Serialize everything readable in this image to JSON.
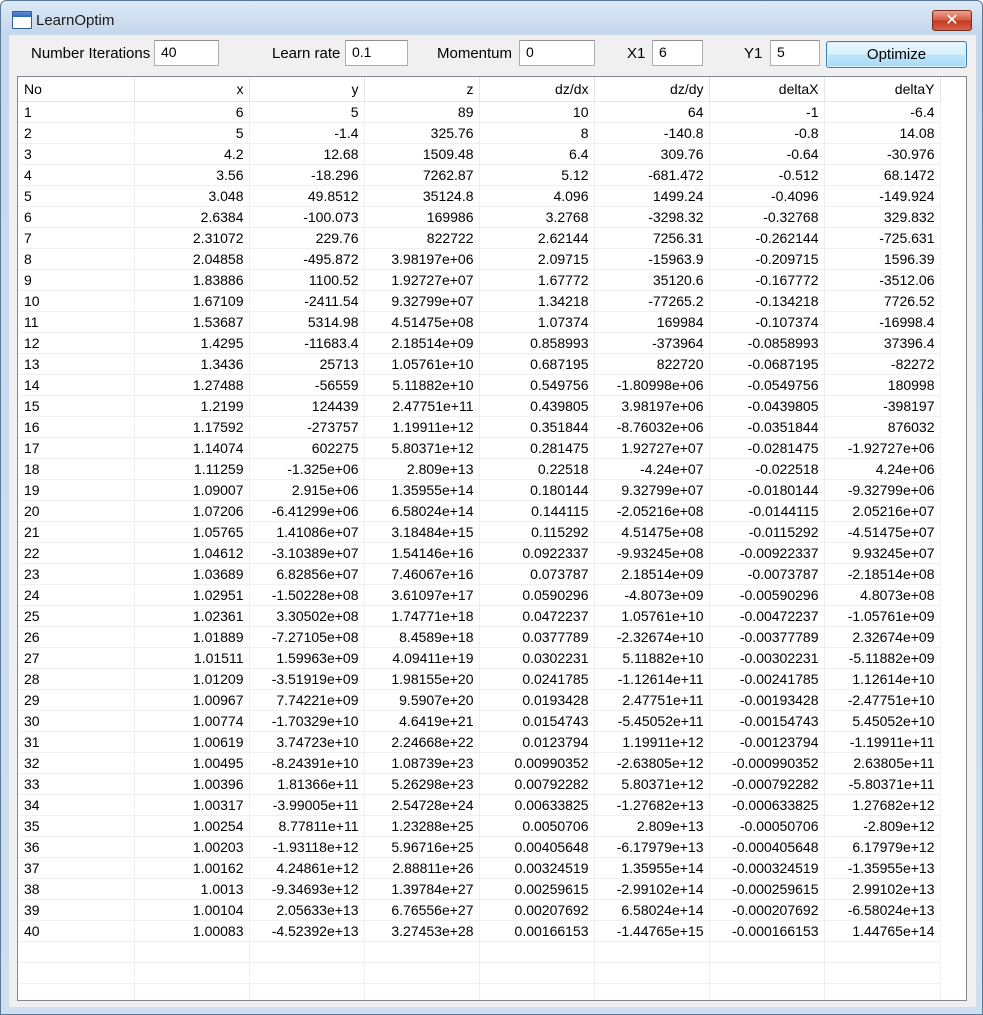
{
  "window": {
    "title": "LearnOptim",
    "close_label": "✕"
  },
  "toolbar": {
    "iterations_label": "Number Iterations",
    "iterations_value": "40",
    "learn_rate_label": "Learn rate",
    "learn_rate_value": "0.1",
    "momentum_label": "Momentum",
    "momentum_value": "0",
    "x1_label": "X1",
    "x1_value": "6",
    "y1_label": "Y1",
    "y1_value": "5",
    "optimize_label": "Optimize"
  },
  "table": {
    "columns": [
      "No",
      "x",
      "y",
      "z",
      "dz/dx",
      "dz/dy",
      "deltaX",
      "deltaY"
    ],
    "rows": [
      [
        "1",
        "6",
        "5",
        "89",
        "10",
        "64",
        "-1",
        "-6.4"
      ],
      [
        "2",
        "5",
        "-1.4",
        "325.76",
        "8",
        "-140.8",
        "-0.8",
        "14.08"
      ],
      [
        "3",
        "4.2",
        "12.68",
        "1509.48",
        "6.4",
        "309.76",
        "-0.64",
        "-30.976"
      ],
      [
        "4",
        "3.56",
        "-18.296",
        "7262.87",
        "5.12",
        "-681.472",
        "-0.512",
        "68.1472"
      ],
      [
        "5",
        "3.048",
        "49.8512",
        "35124.8",
        "4.096",
        "1499.24",
        "-0.4096",
        "-149.924"
      ],
      [
        "6",
        "2.6384",
        "-100.073",
        "169986",
        "3.2768",
        "-3298.32",
        "-0.32768",
        "329.832"
      ],
      [
        "7",
        "2.31072",
        "229.76",
        "822722",
        "2.62144",
        "7256.31",
        "-0.262144",
        "-725.631"
      ],
      [
        "8",
        "2.04858",
        "-495.872",
        "3.98197e+06",
        "2.09715",
        "-15963.9",
        "-0.209715",
        "1596.39"
      ],
      [
        "9",
        "1.83886",
        "1100.52",
        "1.92727e+07",
        "1.67772",
        "35120.6",
        "-0.167772",
        "-3512.06"
      ],
      [
        "10",
        "1.67109",
        "-2411.54",
        "9.32799e+07",
        "1.34218",
        "-77265.2",
        "-0.134218",
        "7726.52"
      ],
      [
        "11",
        "1.53687",
        "5314.98",
        "4.51475e+08",
        "1.07374",
        "169984",
        "-0.107374",
        "-16998.4"
      ],
      [
        "12",
        "1.4295",
        "-11683.4",
        "2.18514e+09",
        "0.858993",
        "-373964",
        "-0.0858993",
        "37396.4"
      ],
      [
        "13",
        "1.3436",
        "25713",
        "1.05761e+10",
        "0.687195",
        "822720",
        "-0.0687195",
        "-82272"
      ],
      [
        "14",
        "1.27488",
        "-56559",
        "5.11882e+10",
        "0.549756",
        "-1.80998e+06",
        "-0.0549756",
        "180998"
      ],
      [
        "15",
        "1.2199",
        "124439",
        "2.47751e+11",
        "0.439805",
        "3.98197e+06",
        "-0.0439805",
        "-398197"
      ],
      [
        "16",
        "1.17592",
        "-273757",
        "1.19911e+12",
        "0.351844",
        "-8.76032e+06",
        "-0.0351844",
        "876032"
      ],
      [
        "17",
        "1.14074",
        "602275",
        "5.80371e+12",
        "0.281475",
        "1.92727e+07",
        "-0.0281475",
        "-1.92727e+06"
      ],
      [
        "18",
        "1.11259",
        "-1.325e+06",
        "2.809e+13",
        "0.22518",
        "-4.24e+07",
        "-0.022518",
        "4.24e+06"
      ],
      [
        "19",
        "1.09007",
        "2.915e+06",
        "1.35955e+14",
        "0.180144",
        "9.32799e+07",
        "-0.0180144",
        "-9.32799e+06"
      ],
      [
        "20",
        "1.07206",
        "-6.41299e+06",
        "6.58024e+14",
        "0.144115",
        "-2.05216e+08",
        "-0.0144115",
        "2.05216e+07"
      ],
      [
        "21",
        "1.05765",
        "1.41086e+07",
        "3.18484e+15",
        "0.115292",
        "4.51475e+08",
        "-0.0115292",
        "-4.51475e+07"
      ],
      [
        "22",
        "1.04612",
        "-3.10389e+07",
        "1.54146e+16",
        "0.0922337",
        "-9.93245e+08",
        "-0.00922337",
        "9.93245e+07"
      ],
      [
        "23",
        "1.03689",
        "6.82856e+07",
        "7.46067e+16",
        "0.073787",
        "2.18514e+09",
        "-0.0073787",
        "-2.18514e+08"
      ],
      [
        "24",
        "1.02951",
        "-1.50228e+08",
        "3.61097e+17",
        "0.0590296",
        "-4.8073e+09",
        "-0.00590296",
        "4.8073e+08"
      ],
      [
        "25",
        "1.02361",
        "3.30502e+08",
        "1.74771e+18",
        "0.0472237",
        "1.05761e+10",
        "-0.00472237",
        "-1.05761e+09"
      ],
      [
        "26",
        "1.01889",
        "-7.27105e+08",
        "8.4589e+18",
        "0.0377789",
        "-2.32674e+10",
        "-0.00377789",
        "2.32674e+09"
      ],
      [
        "27",
        "1.01511",
        "1.59963e+09",
        "4.09411e+19",
        "0.0302231",
        "5.11882e+10",
        "-0.00302231",
        "-5.11882e+09"
      ],
      [
        "28",
        "1.01209",
        "-3.51919e+09",
        "1.98155e+20",
        "0.0241785",
        "-1.12614e+11",
        "-0.00241785",
        "1.12614e+10"
      ],
      [
        "29",
        "1.00967",
        "7.74221e+09",
        "9.5907e+20",
        "0.0193428",
        "2.47751e+11",
        "-0.00193428",
        "-2.47751e+10"
      ],
      [
        "30",
        "1.00774",
        "-1.70329e+10",
        "4.6419e+21",
        "0.0154743",
        "-5.45052e+11",
        "-0.00154743",
        "5.45052e+10"
      ],
      [
        "31",
        "1.00619",
        "3.74723e+10",
        "2.24668e+22",
        "0.0123794",
        "1.19911e+12",
        "-0.00123794",
        "-1.19911e+11"
      ],
      [
        "32",
        "1.00495",
        "-8.24391e+10",
        "1.08739e+23",
        "0.00990352",
        "-2.63805e+12",
        "-0.000990352",
        "2.63805e+11"
      ],
      [
        "33",
        "1.00396",
        "1.81366e+11",
        "5.26298e+23",
        "0.00792282",
        "5.80371e+12",
        "-0.000792282",
        "-5.80371e+11"
      ],
      [
        "34",
        "1.00317",
        "-3.99005e+11",
        "2.54728e+24",
        "0.00633825",
        "-1.27682e+13",
        "-0.000633825",
        "1.27682e+12"
      ],
      [
        "35",
        "1.00254",
        "8.77811e+11",
        "1.23288e+25",
        "0.0050706",
        "2.809e+13",
        "-0.00050706",
        "-2.809e+12"
      ],
      [
        "36",
        "1.00203",
        "-1.93118e+12",
        "5.96716e+25",
        "0.00405648",
        "-6.17979e+13",
        "-0.000405648",
        "6.17979e+12"
      ],
      [
        "37",
        "1.00162",
        "4.24861e+12",
        "2.88811e+26",
        "0.00324519",
        "1.35955e+14",
        "-0.000324519",
        "-1.35955e+13"
      ],
      [
        "38",
        "1.0013",
        "-9.34693e+12",
        "1.39784e+27",
        "0.00259615",
        "-2.99102e+14",
        "-0.000259615",
        "2.99102e+13"
      ],
      [
        "39",
        "1.00104",
        "2.05633e+13",
        "6.76556e+27",
        "0.00207692",
        "6.58024e+14",
        "-0.000207692",
        "-6.58024e+13"
      ],
      [
        "40",
        "1.00083",
        "-4.52392e+13",
        "3.27453e+28",
        "0.00166153",
        "-1.44765e+15",
        "-0.000166153",
        "1.44765e+14"
      ]
    ]
  }
}
